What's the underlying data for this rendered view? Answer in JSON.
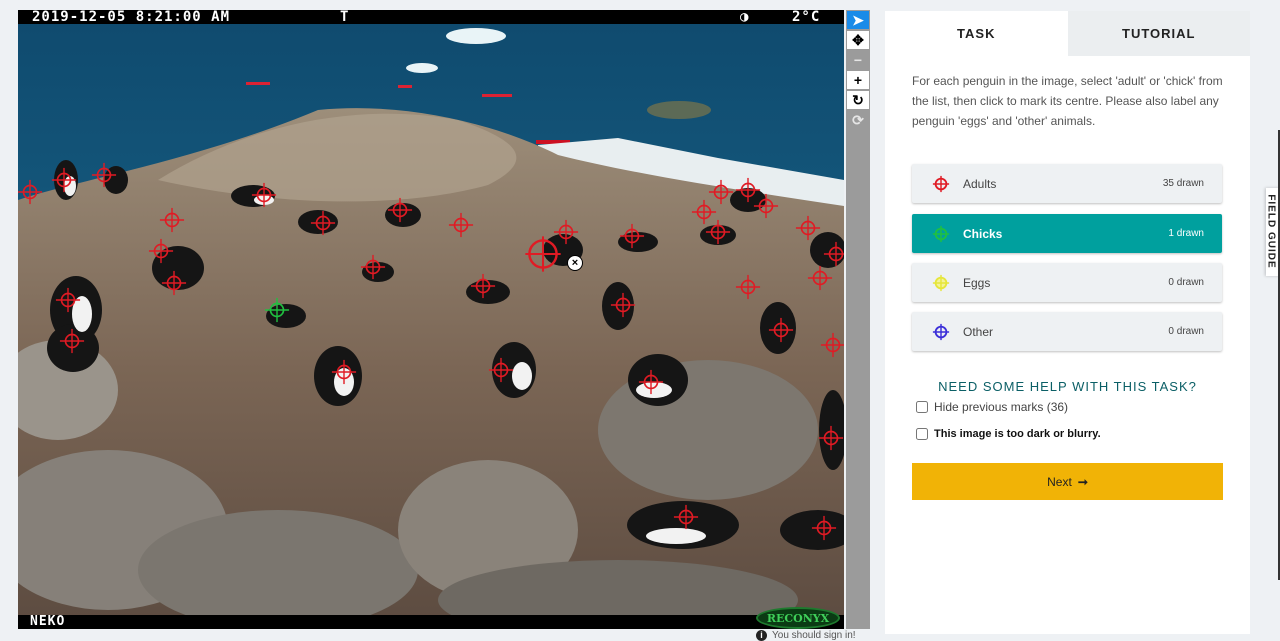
{
  "camera": {
    "timestamp": "2019-12-05 8:21:00 AM",
    "t_label": "T",
    "moon_icon": "half-moon-icon",
    "temperature": "2°C",
    "camera_name": "NEKO",
    "logo_text": "RECONYX"
  },
  "colors": {
    "adult": "#e01b24",
    "chick": "#20c040",
    "egg": "#e6e63a",
    "other": "#3b2fd8",
    "tab_active": "#ffffff",
    "accent": "#00a09e",
    "next": "#f1b306"
  },
  "toolbar": {
    "items": [
      {
        "name": "pointer-icon",
        "glyph": "➤",
        "state": "active"
      },
      {
        "name": "move-icon",
        "glyph": "✥",
        "state": "normal"
      },
      {
        "name": "zoom-out-icon",
        "glyph": "−",
        "state": "disabled"
      },
      {
        "name": "zoom-in-icon",
        "glyph": "+",
        "state": "normal"
      },
      {
        "name": "rotate-icon",
        "glyph": "↻",
        "state": "normal"
      },
      {
        "name": "reset-icon",
        "glyph": "⟳",
        "state": "disabled"
      }
    ]
  },
  "signin_text": "You should sign in!",
  "tabs": {
    "task": "TASK",
    "tutorial": "TUTORIAL"
  },
  "instructions": "For each penguin in the image, select 'adult' or 'chick' from the list, then click to mark its centre. Please also label any penguin 'eggs' and 'other' animals.",
  "tools": [
    {
      "label": "Adults",
      "count": "35 drawn",
      "icon": "crosshair-icon",
      "color": "#e01b24"
    },
    {
      "label": "Chicks",
      "count": "1 drawn",
      "icon": "crosshair-icon",
      "color": "#20c040"
    },
    {
      "label": "Eggs",
      "count": "0 drawn",
      "icon": "crosshair-icon",
      "color": "#e6e63a"
    },
    {
      "label": "Other",
      "count": "0 drawn",
      "icon": "crosshair-icon",
      "color": "#3b2fd8"
    }
  ],
  "help": {
    "title": "NEED SOME HELP WITH THIS TASK?",
    "hide_marks": "Hide previous marks (36)",
    "too_dark": "This image is too dark or blurry."
  },
  "next": {
    "label": "Next",
    "arrow": "➞"
  },
  "field_guide": "FIELD GUIDE"
}
